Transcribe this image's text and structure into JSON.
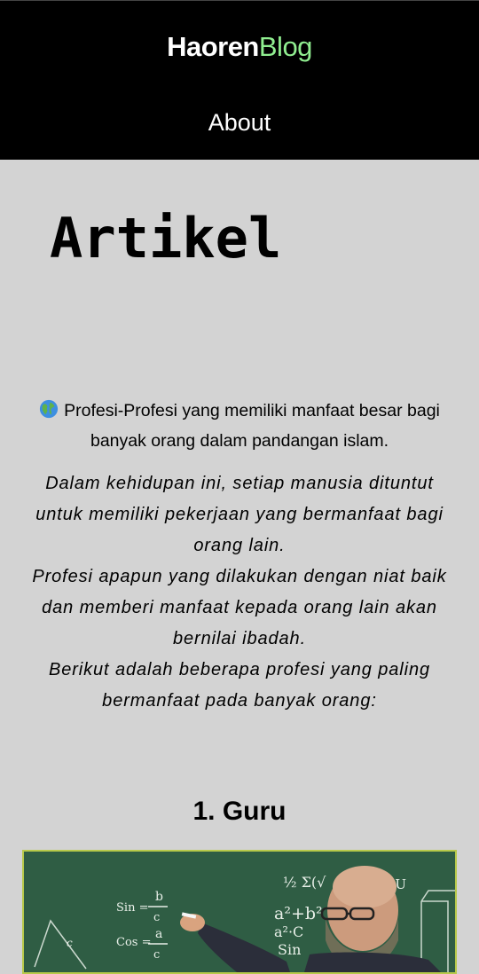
{
  "header": {
    "brand_main": "Haoren",
    "brand_accent": "Blog",
    "nav_about": "About"
  },
  "page": {
    "title": "Artikel"
  },
  "article": {
    "title_icon": "globe-icon",
    "title_line1": "Profesi-Profesi yang memiliki manfaat besar bagi",
    "title_line2": "banyak orang dalam pandangan islam.",
    "intro_lines": [
      "Dalam kehidupan ini, setiap manusia dituntut",
      "untuk memiliki pekerjaan yang bermanfaat bagi",
      "orang lain.",
      "Profesi apapun yang dilakukan dengan niat baik",
      "dan memberi manfaat kepada orang lain akan",
      "bernilai ibadah.",
      "Berikut adalah beberapa profesi yang paling",
      "bermanfaat pada banyak orang:"
    ]
  },
  "sections": [
    {
      "heading": "1. Guru",
      "image_chalk": {
        "sin_label": "Sin =",
        "sin_num": "b",
        "sin_den": "c",
        "cos_label": "Cos =",
        "cos_num": "a",
        "cos_den": "c",
        "side_c": "c",
        "formula_1": "a²+b²",
        "formula_2": "a²·C",
        "formula_3": "Sin",
        "formula_top": "½ Σ(√",
        "formula_right": ")=U"
      }
    }
  ],
  "colors": {
    "header_bg": "#000000",
    "brand_accent": "#90ee90",
    "page_bg": "#d3d3d3",
    "chalkboard": "#2f5d44",
    "image_border": "#b7c94a"
  }
}
